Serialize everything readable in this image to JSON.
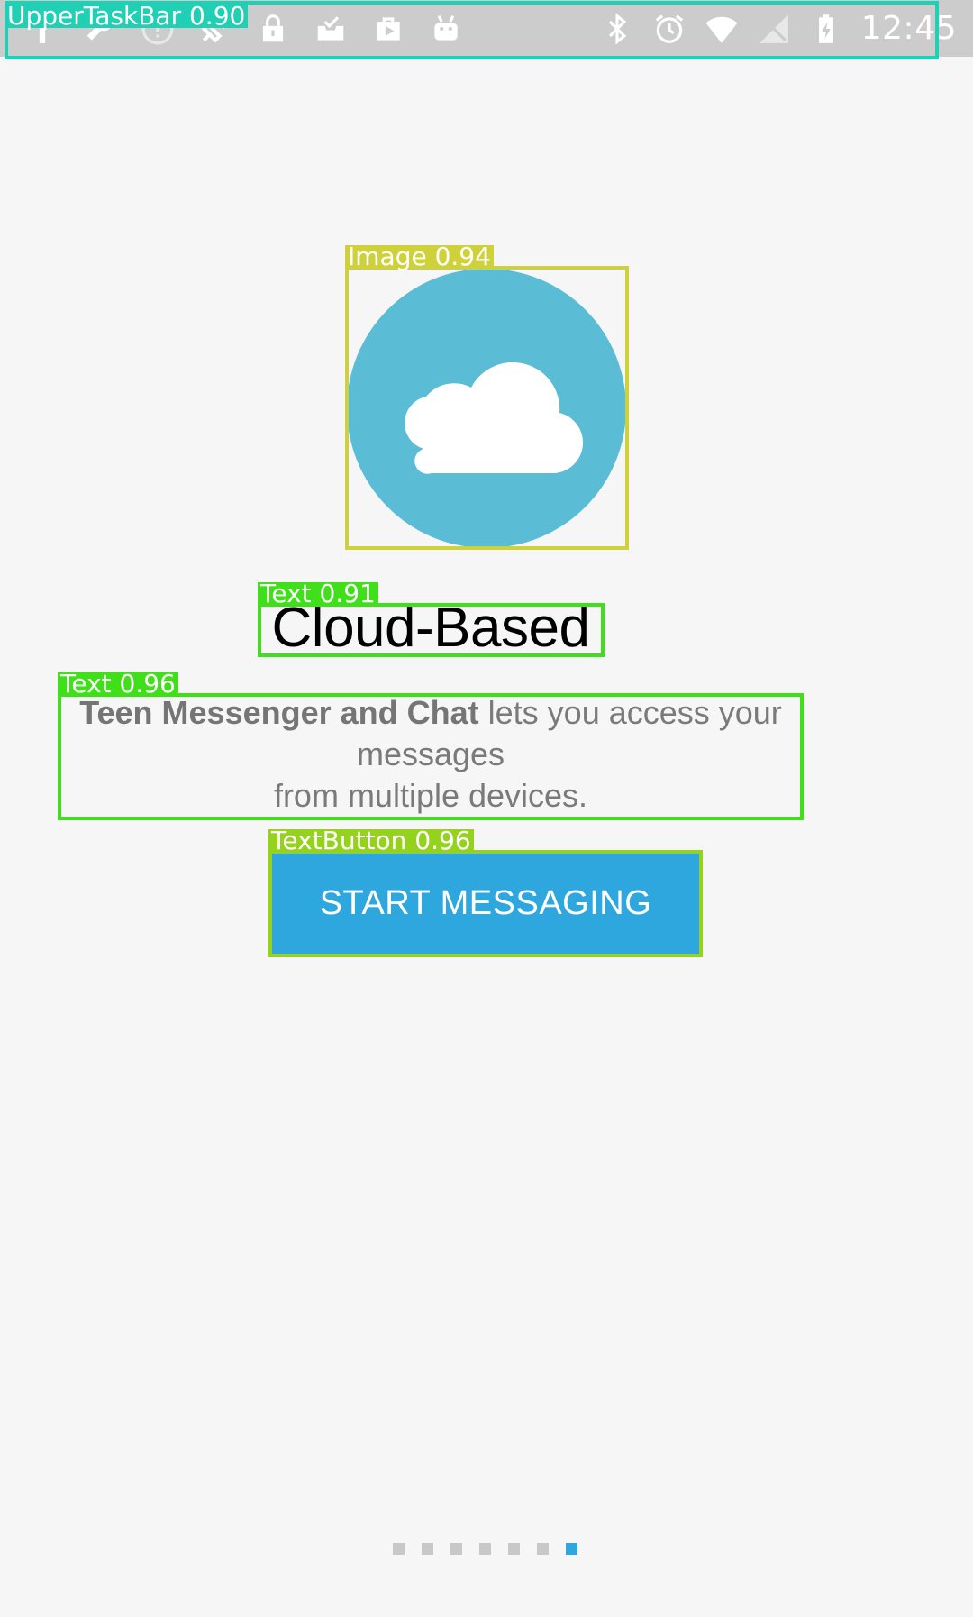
{
  "status_bar": {
    "clock": "12:45",
    "left_icons": [
      "torch-icon",
      "wrench-icon",
      "info-icon",
      "satellite-icon",
      "lock-icon",
      "inbox-icon",
      "play-store-icon",
      "android-icon"
    ],
    "right_icons": [
      "bluetooth-icon",
      "alarm-icon",
      "wifi-icon",
      "no-signal-icon",
      "battery-charging-icon"
    ]
  },
  "hero": {
    "image_icon": "cloud-icon",
    "circle_color": "#5bbcd6",
    "title": "Cloud-Based",
    "description_bold": "Teen Messenger and Chat",
    "description_line1_rest": " lets you access your",
    "description_line2": "messages",
    "description_line3": "from multiple devices."
  },
  "primary_action": {
    "label": "START MESSAGING",
    "color": "#2ea6de"
  },
  "pager": {
    "total": 7,
    "active_index": 6,
    "active_color": "#2ea6de",
    "inactive_color": "#c8c8c8"
  },
  "detections": [
    {
      "name": "upper-taskbar-box",
      "label": "UpperTaskBar 0.90",
      "color": "#1fd0b4"
    },
    {
      "name": "image-box",
      "label": "Image 0.94",
      "color": "#cfd13a"
    },
    {
      "name": "title-text-box",
      "label": "Text 0.91",
      "color": "#3fe01a"
    },
    {
      "name": "description-text-box",
      "label": "Text 0.96",
      "color": "#3fe01a"
    },
    {
      "name": "button-box",
      "label": "TextButton 0.96",
      "color": "#94d21e"
    }
  ]
}
